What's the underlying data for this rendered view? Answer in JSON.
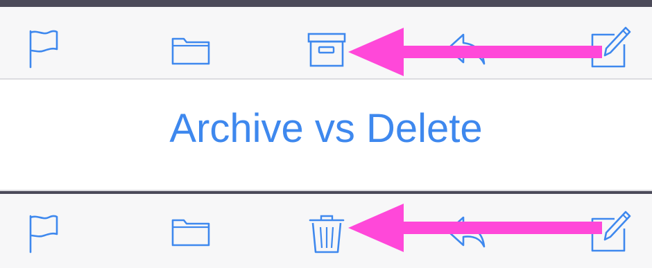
{
  "title": "Archive vs Delete",
  "colors": {
    "icon": "#3e88ee",
    "arrow": "#ff48d9",
    "toolbar_bg": "#f7f7f8",
    "frame": "#4b4a59"
  },
  "top_toolbar": {
    "icons": [
      "flag-icon",
      "folder-icon",
      "archive-icon",
      "reply-icon",
      "compose-icon"
    ]
  },
  "bottom_toolbar": {
    "icons": [
      "flag-icon",
      "folder-icon",
      "trash-icon",
      "reply-icon",
      "compose-icon"
    ]
  },
  "annotations": {
    "arrows": [
      "pointing to archive icon",
      "pointing to trash icon"
    ]
  }
}
